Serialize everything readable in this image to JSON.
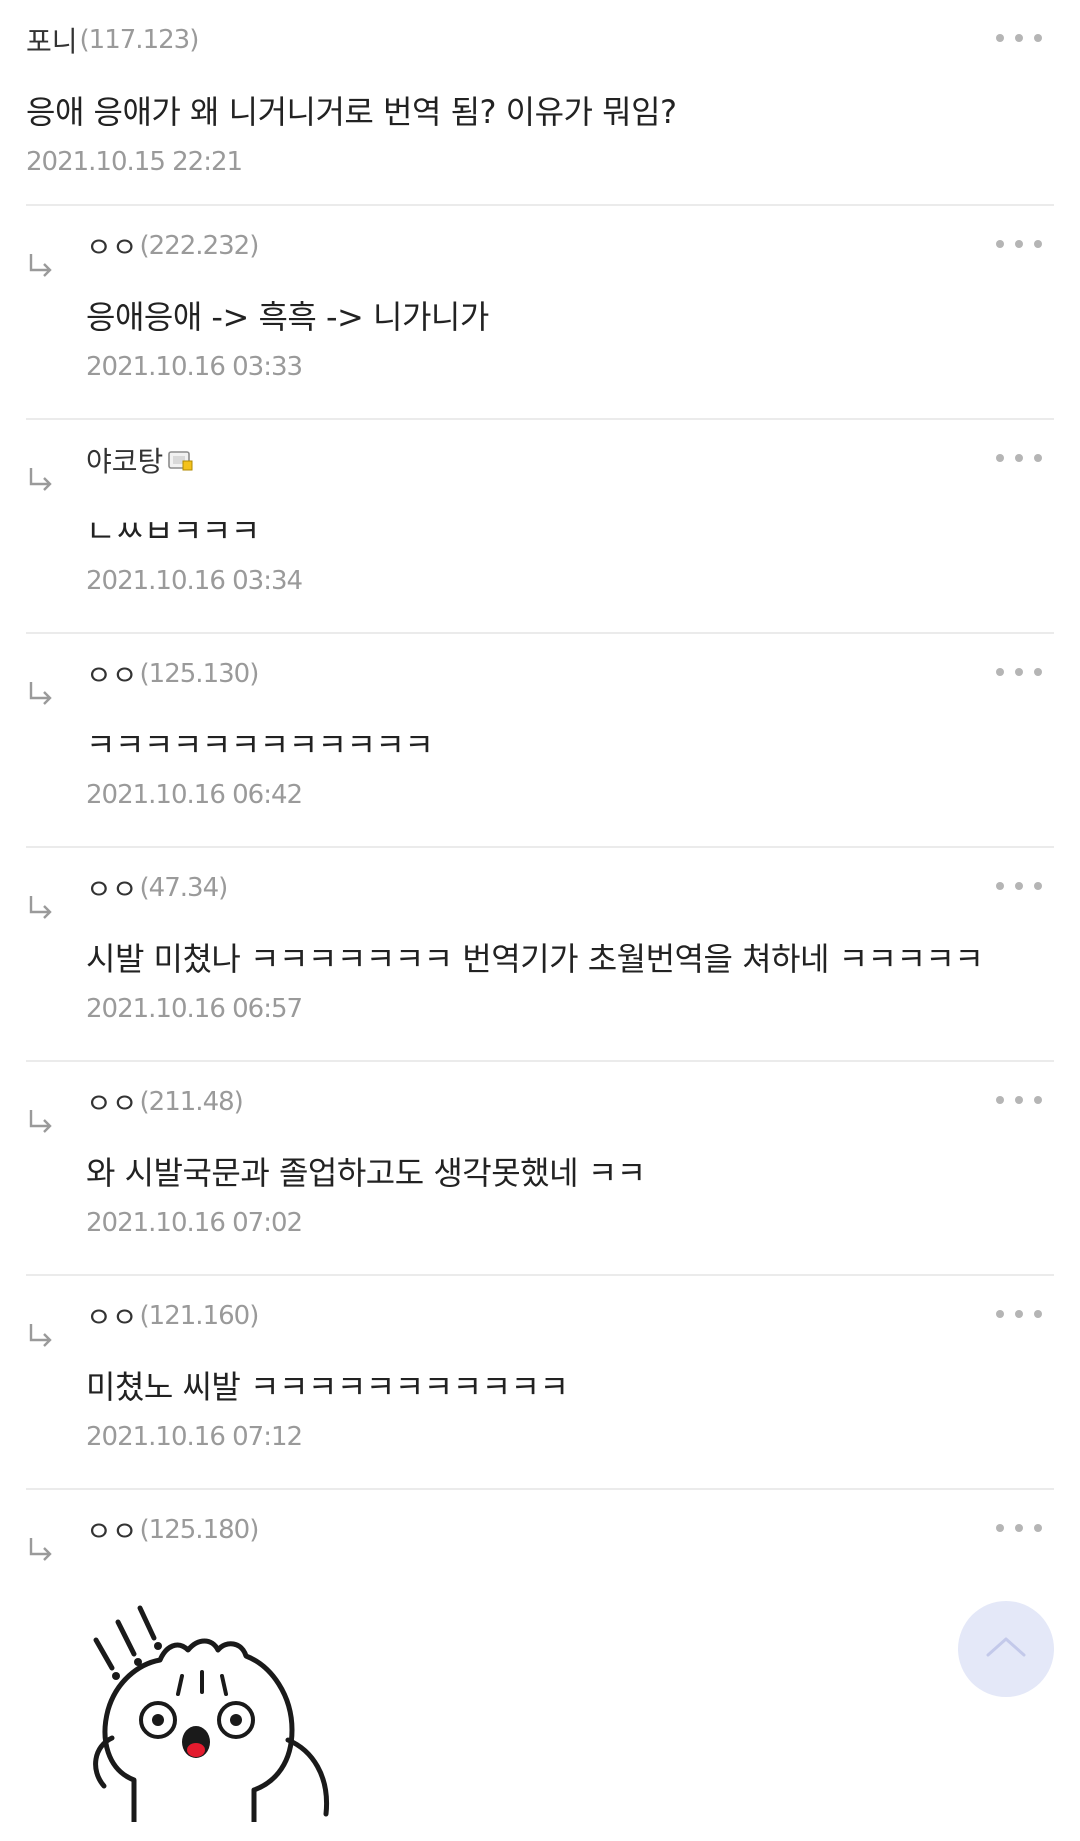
{
  "post": {
    "nickname": "포니",
    "ip": "(117.123)",
    "text": "응애 응애가 왜 니거니거로 번역 됨? 이유가 뭐임?",
    "date": "2021.10.15 22:21"
  },
  "replies": [
    {
      "nickname": "ㅇㅇ",
      "ip": "(222.232)",
      "text": "응애응애 -> 흑흑 -> 니가니가",
      "date": "2021.10.16 03:33"
    },
    {
      "nickname": "야코탕",
      "ip": "",
      "badge_icon": "gallery-manager-icon",
      "text": "ㄴㅆㅂㅋㅋㅋ",
      "date": "2021.10.16 03:34"
    },
    {
      "nickname": "ㅇㅇ",
      "ip": "(125.130)",
      "text": "ㅋㅋㅋㅋㅋㅋㅋㅋㅋㅋㅋㅋ",
      "date": "2021.10.16 06:42"
    },
    {
      "nickname": "ㅇㅇ",
      "ip": "(47.34)",
      "text": "시발 미쳤나 ㅋㅋㅋㅋㅋㅋㅋ 번역기가 초월번역을 쳐하네 ㅋㅋㅋㅋㅋ",
      "date": "2021.10.16 06:57"
    },
    {
      "nickname": "ㅇㅇ",
      "ip": "(211.48)",
      "text": "와 시발국문과 졸업하고도 생각못했네 ㅋㅋ",
      "date": "2021.10.16 07:02"
    },
    {
      "nickname": "ㅇㅇ",
      "ip": "(121.160)",
      "text": "미쳤노 씨발 ㅋㅋㅋㅋㅋㅋㅋㅋㅋㅋㅋ",
      "date": "2021.10.16 07:12"
    },
    {
      "nickname": "ㅇㅇ",
      "ip": "(125.180)",
      "sticker": "surprised-dumpling-sticker"
    }
  ],
  "icons": {
    "reply": "reply-arrow-icon",
    "more": "more-options-icon",
    "scroll_top": "chevron-up-icon"
  },
  "colors": {
    "text": "#222222",
    "meta": "#9a9a9a",
    "divider": "#ebebeb",
    "scroll_button": "#e4e8f8"
  }
}
